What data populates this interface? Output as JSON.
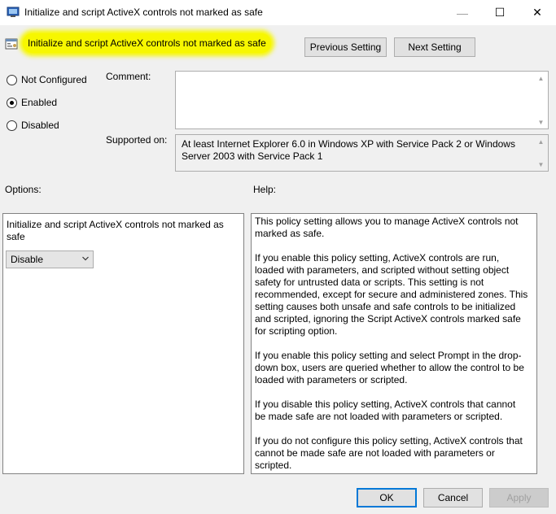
{
  "window": {
    "title": "Initialize and script ActiveX controls not marked as safe",
    "minimize_glyph": "—",
    "maximize_glyph": "☐",
    "close_glyph": "✕"
  },
  "header": {
    "policy_title": "Initialize and script ActiveX controls not marked as safe",
    "previous_setting": "Previous Setting",
    "next_setting": "Next Setting"
  },
  "state": {
    "options": [
      {
        "label": "Not Configured",
        "selected": false
      },
      {
        "label": "Enabled",
        "selected": true
      },
      {
        "label": "Disabled",
        "selected": false
      }
    ]
  },
  "comment": {
    "label": "Comment:",
    "value": ""
  },
  "supported": {
    "label": "Supported on:",
    "value": "At least Internet Explorer 6.0 in Windows XP with Service Pack 2 or Windows Server 2003 with Service Pack 1"
  },
  "options_section": {
    "label": "Options:",
    "description": "Initialize and script ActiveX controls not marked as safe",
    "dropdown_value": "Disable"
  },
  "help_section": {
    "label": "Help:",
    "paragraphs": [
      "This policy setting allows you to manage ActiveX controls not marked as safe.",
      "If you enable this policy setting, ActiveX controls are run, loaded with parameters, and scripted without setting object safety for untrusted data or scripts. This setting is not recommended, except for secure and administered zones. This setting causes both unsafe and safe controls to be initialized and scripted, ignoring the Script ActiveX controls marked safe for scripting option.",
      "If you enable this policy setting and select Prompt in the drop-down box, users are queried whether to allow the control to be loaded with parameters or scripted.",
      "If you disable this policy setting, ActiveX controls that cannot be made safe are not loaded with parameters or scripted.",
      "If you do not configure this policy setting, ActiveX controls that cannot be made safe are not loaded with parameters or scripted."
    ]
  },
  "footer": {
    "ok": "OK",
    "cancel": "Cancel",
    "apply": "Apply"
  },
  "icons": {
    "window": "policy-window-icon",
    "policy": "policy-setting-icon",
    "dropdown": "chevron-down-icon"
  },
  "colors": {
    "highlight": "#f7f700",
    "focus_border": "#0078d7"
  }
}
